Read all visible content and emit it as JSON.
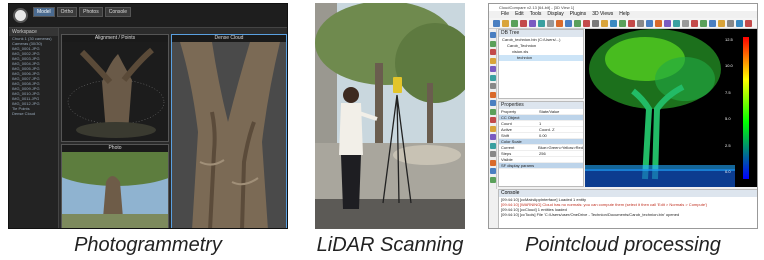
{
  "captions": {
    "photogrammetry": "Photogrammetry",
    "lidar": "LiDAR Scanning",
    "pointcloud": "Pointcloud processing"
  },
  "photogrammetry_app": {
    "tabs": [
      "Model",
      "Ortho",
      "Photos",
      "Console"
    ],
    "sidebar_header": "Workspace",
    "sidebar_items": [
      "Chunk 1 (30 cameras)",
      "Cameras (30/30)",
      "IMG_0001.JPG",
      "IMG_0002.JPG",
      "IMG_0003.JPG",
      "IMG_0004.JPG",
      "IMG_0005.JPG",
      "IMG_0006.JPG",
      "IMG_0007.JPG",
      "IMG_0008.JPG",
      "IMG_0009.JPG",
      "IMG_0010.JPG",
      "IMG_0011.JPG",
      "IMG_0012.JPG",
      "Tie Points",
      "Dense Cloud"
    ],
    "views": [
      "Alignment / Points",
      "Dense Cloud",
      "Photo"
    ]
  },
  "cloudcompare": {
    "title": "CloudCompare v2.13 [64-bit] - [3D View 1]",
    "menu": [
      "File",
      "Edit",
      "Tools",
      "Display",
      "Plugins",
      "3D Views",
      "Help"
    ],
    "db_tree_header": "DB Tree",
    "db_tree": [
      {
        "label": "Carob_technion.bin (C:/Users/...)",
        "selected": false
      },
      {
        "label": "Carob_Technion",
        "selected": false
      },
      {
        "label": "vision.xls",
        "selected": false
      },
      {
        "label": "technion",
        "selected": true
      }
    ],
    "properties_header": "Properties",
    "properties": [
      {
        "k": "Property",
        "v": "State/Value",
        "section": false
      },
      {
        "k": "CC Object",
        "v": "",
        "section": true
      },
      {
        "k": "Count",
        "v": "1",
        "section": false
      },
      {
        "k": "Active",
        "v": "Coord. Z",
        "section": false
      },
      {
        "k": "Shift",
        "v": "0.00",
        "section": false
      },
      {
        "k": "Color Scale",
        "v": "",
        "section": true
      },
      {
        "k": "Current",
        "v": "Blue>Green>Yellow>Red",
        "section": false
      },
      {
        "k": "Steps",
        "v": "256",
        "section": false
      },
      {
        "k": "Visible",
        "v": "",
        "section": false
      },
      {
        "k": "SF display params",
        "v": "",
        "section": true
      }
    ],
    "console_header": "Console",
    "console_lines": [
      {
        "text": "[09:44:10] [ccMainAppInterface] Loaded 1 entity",
        "warn": false
      },
      {
        "text": "[09:44:10] [WARNING] Cloud has no normals: you can compute them (select it then call 'Edit > Normals > Compute')",
        "warn": true
      },
      {
        "text": "[09:44:10] [ccCloud] 1 entities loaded",
        "warn": false
      },
      {
        "text": "[09:44:10] [ccTools] File 'C:/Users/user/OneDrive - Technion/Documents/Carob_technion.bin' opened",
        "warn": false
      }
    ],
    "scale_labels": [
      "0.0",
      "2.5",
      "5.0",
      "7.5",
      "10.0",
      "12.5"
    ],
    "colors": {
      "scale_top": "#ff0000",
      "scale_mid": "#ffff00",
      "scale_low": "#00ff00",
      "scale_bottom": "#0000ff"
    }
  }
}
